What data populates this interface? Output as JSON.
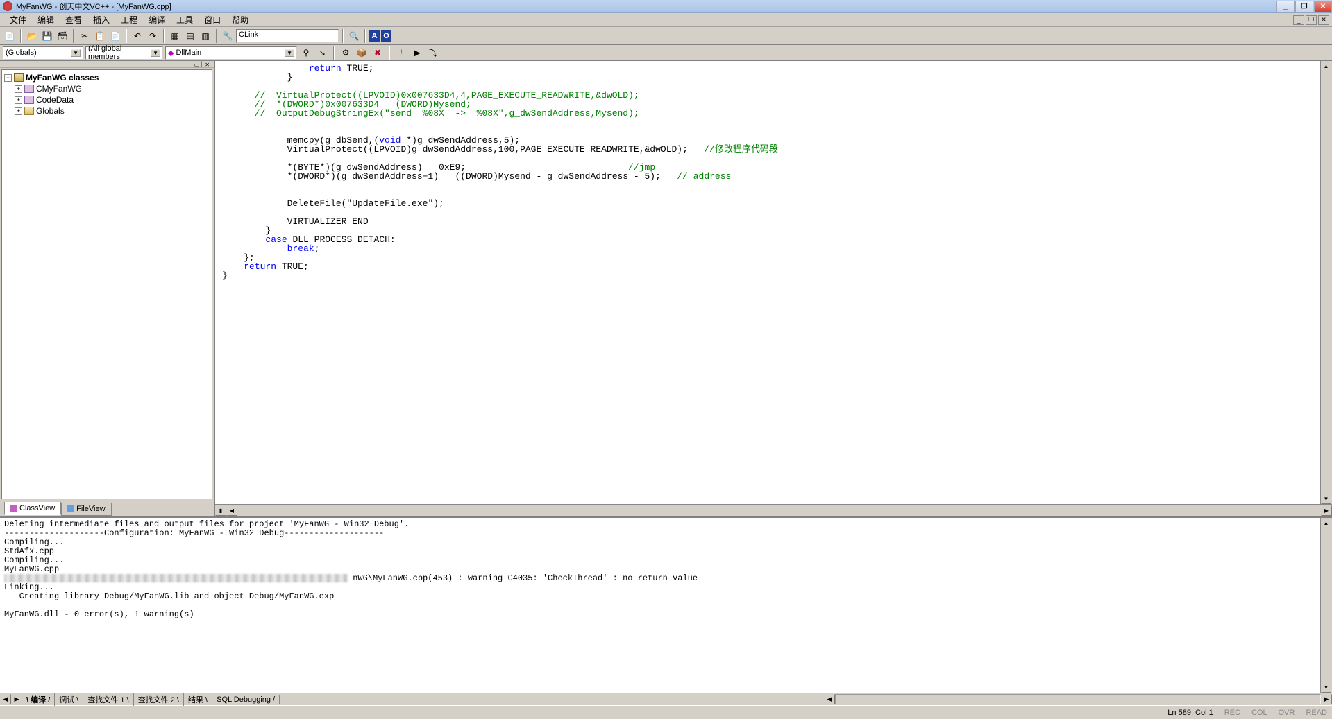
{
  "title": "MyFanWG - 创天中文VC++ - [MyFanWG.cpp]",
  "menu": [
    "文件",
    "编辑",
    "查看",
    "插入",
    "工程",
    "编译",
    "工具",
    "窗口",
    "帮助"
  ],
  "toolbar1": {
    "combo_class": "CLink"
  },
  "toolbar2": {
    "scope": "(Globals)",
    "members": "(All global members",
    "func": "DllMain"
  },
  "tree": {
    "root": "MyFanWG classes",
    "children": [
      "CMyFanWG",
      "CodeData",
      "Globals"
    ]
  },
  "left_tabs": {
    "classview": "ClassView",
    "fileview": "FileView"
  },
  "code": {
    "l1_a": "                ",
    "l1_b": "return",
    "l1_c": " TRUE;",
    "l2": "            }",
    "l3": "",
    "l4": "      //  VirtualProtect((LPVOID)0x007633D4,4,PAGE_EXECUTE_READWRITE,&dwOLD);",
    "l5": "      //  *(DWORD*)0x007633D4 = (DWORD)Mysend;",
    "l6": "      //  OutputDebugStringEx(\"send  %08X  ->  %08X\",g_dwSendAddress,Mysend);",
    "l7": "",
    "l8": "",
    "l9_a": "            memcpy(g_dbSend,(",
    "l9_b": "void",
    "l9_c": " *)g_dwSendAddress,5);",
    "l10_a": "            VirtualProtect((LPVOID)g_dwSendAddress,100,PAGE_EXECUTE_READWRITE,&dwOLD);   ",
    "l10_b": "//修改程序代码段",
    "l11": "",
    "l12_a": "            *(BYTE*)(g_dwSendAddress) = 0xE9;                              ",
    "l12_b": "//jmp",
    "l13_a": "            *(DWORD*)(g_dwSendAddress+1) = ((DWORD)Mysend - g_dwSendAddress - 5);   ",
    "l13_b": "// address",
    "l14": "",
    "l15": "",
    "l16": "            DeleteFile(\"UpdateFile.exe\");",
    "l17": "",
    "l18": "            VIRTUALIZER_END",
    "l19": "        }",
    "l20_a": "        ",
    "l20_b": "case",
    "l20_c": " DLL_PROCESS_DETACH:",
    "l21_a": "            ",
    "l21_b": "break",
    "l21_c": ";",
    "l22": "    };",
    "l23_a": "    ",
    "l23_b": "return",
    "l23_c": " TRUE;",
    "l24": "}"
  },
  "output": {
    "l1": "Deleting intermediate files and output files for project 'MyFanWG - Win32 Debug'.",
    "l2": "--------------------Configuration: MyFanWG - Win32 Debug--------------------",
    "l3": "Compiling...",
    "l4": "StdAfx.cpp",
    "l5": "Compiling...",
    "l6": "MyFanWG.cpp",
    "l7_b": " nWG\\MyFanWG.cpp(453) : warning C4035: 'CheckThread' : no return value",
    "l8": "Linking...",
    "l9": "   Creating library Debug/MyFanWG.lib and object Debug/MyFanWG.exp",
    "l10": "",
    "l11": "MyFanWG.dll - 0 error(s), 1 warning(s)"
  },
  "output_tabs": [
    "编译",
    "调试",
    "查找文件 1",
    "查找文件 2",
    "结果",
    "SQL Debugging"
  ],
  "status": {
    "main": "",
    "pos": "Ln 589, Col 1",
    "rec": "REC",
    "col": "COL",
    "ovr": "OVR",
    "read": "READ"
  }
}
